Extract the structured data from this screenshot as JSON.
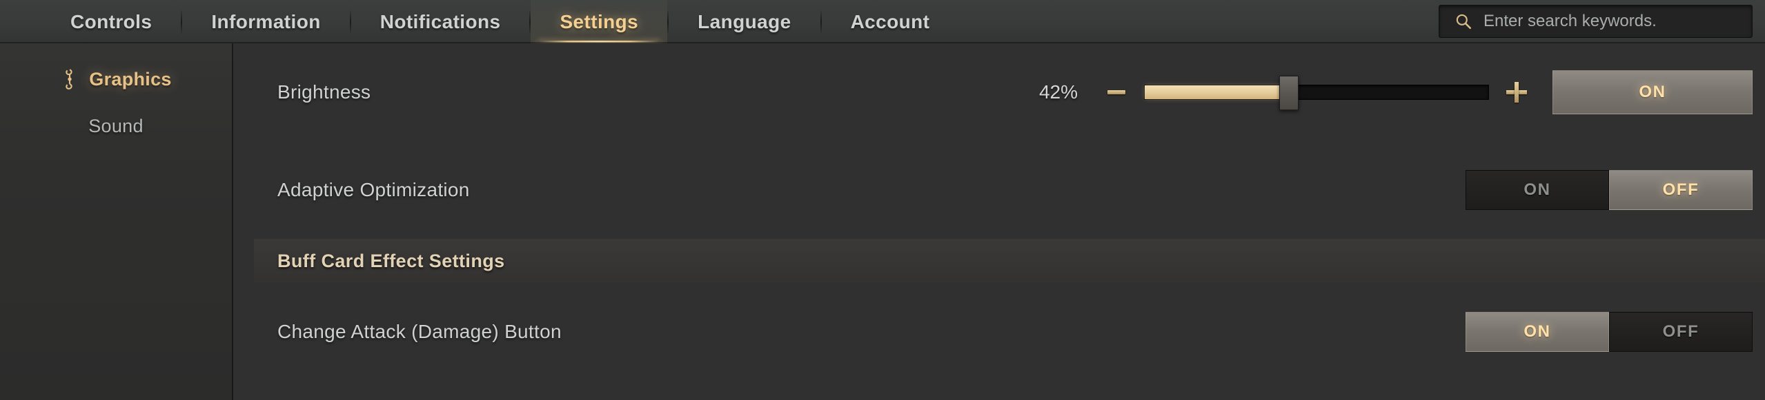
{
  "topbar": {
    "tabs": [
      {
        "label": "Controls",
        "active": false
      },
      {
        "label": "Information",
        "active": false
      },
      {
        "label": "Notifications",
        "active": false
      },
      {
        "label": "Settings",
        "active": true
      },
      {
        "label": "Language",
        "active": false
      },
      {
        "label": "Account",
        "active": false
      }
    ],
    "search": {
      "placeholder": "Enter search keywords.",
      "value": "",
      "icon": "search-icon"
    }
  },
  "sidebar": {
    "items": [
      {
        "label": "Graphics",
        "active": true,
        "icon": "ornament-icon"
      },
      {
        "label": "Sound",
        "active": false,
        "icon": ""
      }
    ]
  },
  "main": {
    "rows": [
      {
        "label": "Brightness",
        "slider": {
          "value_label": "42%",
          "percent": 42,
          "minus_label": "minus-icon",
          "plus_label": "plus-icon"
        },
        "button": {
          "label": "ON",
          "state": "on"
        }
      },
      {
        "label": "Adaptive Optimization",
        "toggle": [
          {
            "label": "ON",
            "selected": false
          },
          {
            "label": "OFF",
            "selected": true
          }
        ]
      }
    ],
    "section": {
      "title": "Buff Card Effect Settings"
    },
    "section_rows": [
      {
        "label": "Change Attack (Damage) Button",
        "toggle": [
          {
            "label": "ON",
            "selected": true
          },
          {
            "label": "OFF",
            "selected": false
          }
        ]
      }
    ]
  },
  "colors": {
    "accent_gold": "#e6c188",
    "text_primary": "#cfd2d1",
    "bg_panel": "#303030",
    "slider_fill": "#e6cd9c"
  }
}
